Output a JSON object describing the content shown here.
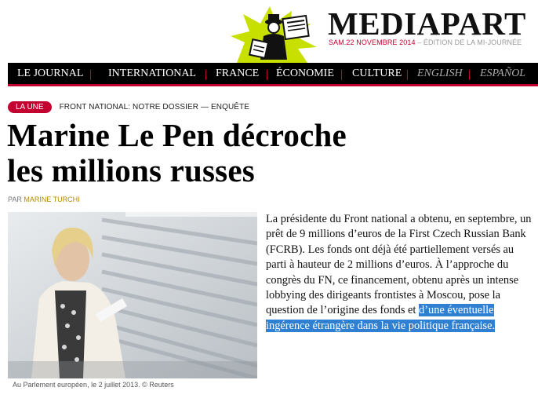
{
  "site": {
    "name": "MEDIAPART",
    "edition_date": "SAM.22 NOVEMBRE 2014",
    "edition_rest": " – ÉDITION DE LA MI-JOURNÉE"
  },
  "nav": {
    "items": [
      {
        "label": "LE JOURNAL"
      },
      {
        "label": "INTERNATIONAL"
      },
      {
        "label": "FRANCE"
      },
      {
        "label": "ÉCONOMIE"
      },
      {
        "label": "CULTURE"
      }
    ],
    "langs": [
      {
        "label": "ENGLISH"
      },
      {
        "label": "ESPAÑOL"
      }
    ]
  },
  "colors": {
    "accent": "#c3002f",
    "selection": "#2f7fd3",
    "logo_burst": "#c8e000"
  },
  "article": {
    "badge": "LA UNE",
    "dossier": "FRONT NATIONAL: NOTRE DOSSIER — ENQUÊTE",
    "title_line1": "Marine Le Pen décroche",
    "title_line2": "les millions russes",
    "byline_prefix": "PAR ",
    "author": "MARINE TURCHI",
    "caption": "Au Parlement européen, le 2 juillet 2013. © Reuters",
    "lead_plain": "La présidente du Front national a obtenu, en septembre, un prêt de 9 millions d’euros de la First Czech Russian Bank (FCRB). Les fonds ont déjà été partiellement versés au parti à hauteur de 2 millions d’euros. À l’approche du congrès du FN, ce financement, obtenu après un intense lobbying des dirigeants frontistes à Moscou, pose la question de l’origine des fonds et ",
    "lead_selected": "d’une éventuelle ingérence étrangère dans la vie politique française."
  }
}
